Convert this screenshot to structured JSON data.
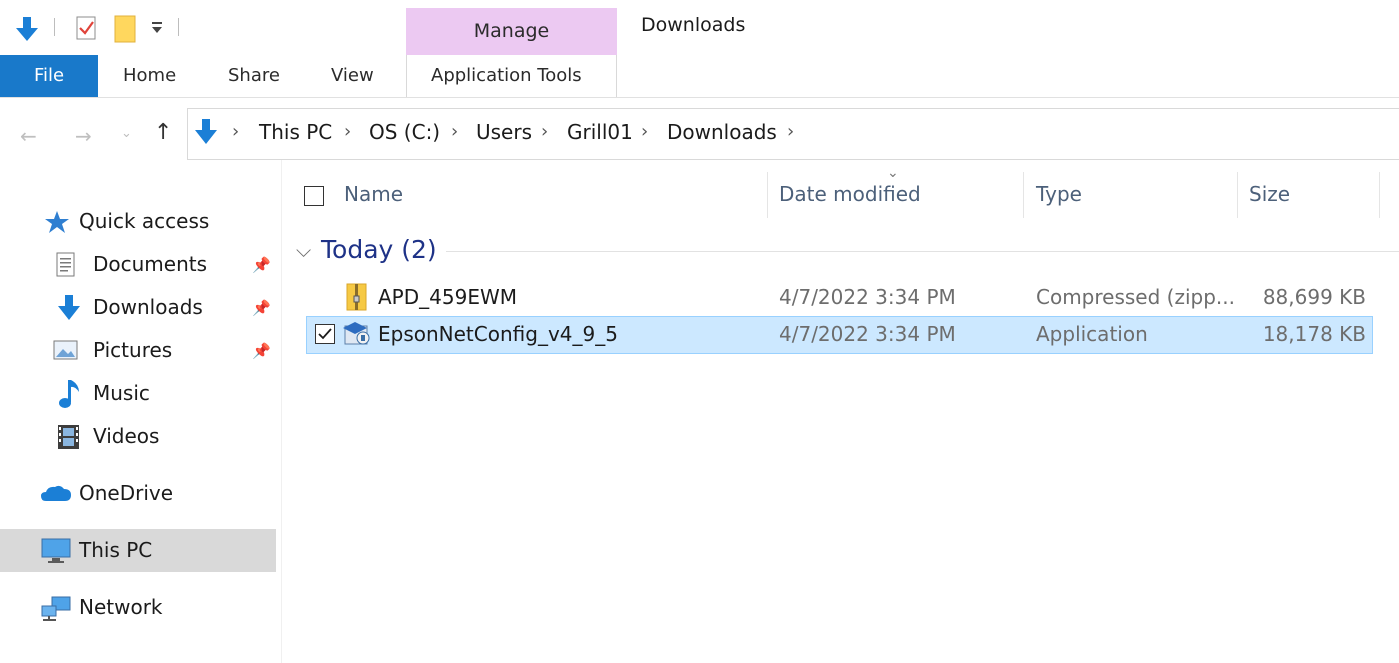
{
  "window": {
    "title": "Downloads",
    "context_group_label": "Manage"
  },
  "ribbon": {
    "tabs": {
      "file": "File",
      "home": "Home",
      "share": "Share",
      "view": "View",
      "app_tools": "Application Tools"
    }
  },
  "addressbar": {
    "crumbs": [
      "This PC",
      "OS (C:)",
      "Users",
      "Grill01",
      "Downloads"
    ]
  },
  "navpane": {
    "quick_access": "Quick access",
    "documents": "Documents",
    "downloads": "Downloads",
    "pictures": "Pictures",
    "music": "Music",
    "videos": "Videos",
    "onedrive": "OneDrive",
    "thispc": "This PC",
    "network": "Network"
  },
  "columns": {
    "name": "Name",
    "date": "Date modified",
    "type": "Type",
    "size": "Size"
  },
  "group": {
    "title": "Today (2)"
  },
  "files": [
    {
      "name": "APD_459EWM",
      "date": "4/7/2022 3:34 PM",
      "type": "Compressed (zipp...",
      "size": "88,699 KB"
    },
    {
      "name": "EpsonNetConfig_v4_9_5",
      "date": "4/7/2022 3:34 PM",
      "type": "Application",
      "size": "18,178 KB"
    }
  ],
  "colors": {
    "accent": "#1979ca",
    "context_tab": "#ecc9f2",
    "selection": "#cce8ff",
    "selection_border": "#99d1ff",
    "group_title": "#1e3287"
  },
  "icons": {
    "qat": [
      "download-arrow-icon",
      "properties-check-icon",
      "new-folder-icon",
      "customize-dropdown-icon"
    ]
  }
}
